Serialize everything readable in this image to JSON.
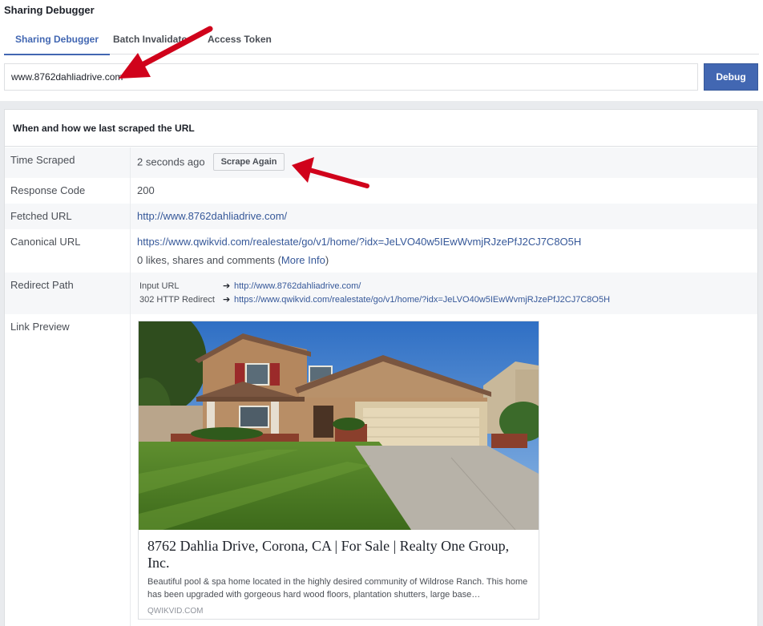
{
  "page": {
    "title": "Sharing Debugger"
  },
  "tabs": [
    {
      "label": "Sharing Debugger",
      "active": true
    },
    {
      "label": "Batch Invalidator",
      "active": false
    },
    {
      "label": "Access Token",
      "active": false
    }
  ],
  "search": {
    "value": "www.8762dahliadrive.com",
    "button_label": "Debug"
  },
  "panel": {
    "header": "When and how we last scraped the URL",
    "time_scraped": {
      "label": "Time Scraped",
      "value": "2 seconds ago",
      "button_label": "Scrape Again"
    },
    "response_code": {
      "label": "Response Code",
      "value": "200"
    },
    "fetched_url": {
      "label": "Fetched URL",
      "value": "http://www.8762dahliadrive.com/"
    },
    "canonical_url": {
      "label": "Canonical URL",
      "value": "https://www.qwikvid.com/realestate/go/v1/home/?idx=JeLVO40w5IEwWvmjRJzePfJ2CJ7C8O5H",
      "engagement_prefix": "0 likes, shares and comments (",
      "engagement_link": "More Info",
      "engagement_suffix": ")"
    },
    "redirect_path": {
      "label": "Redirect Path",
      "entries": [
        {
          "key": "Input URL",
          "url": "http://www.8762dahliadrive.com/"
        },
        {
          "key": "302 HTTP Redirect",
          "url": "https://www.qwikvid.com/realestate/go/v1/home/?idx=JeLVO40w5IEwWvmjRJzePfJ2CJ7C8O5H"
        }
      ]
    },
    "link_preview": {
      "label": "Link Preview",
      "title": "8762 Dahlia Drive, Corona, CA | For Sale | Realty One Group, Inc.",
      "description": "Beautiful pool & spa home located in the highly desired community of Wildrose Ranch. This home has been upgraded with gorgeous hard wood floors, plantation shutters, large base…",
      "domain": "QWIKVID.COM"
    }
  },
  "colors": {
    "accent": "#4267b2",
    "link": "#365899",
    "annotation": "#d0021b"
  },
  "icons": {
    "redirect_arrow": "arrow-right-icon"
  }
}
